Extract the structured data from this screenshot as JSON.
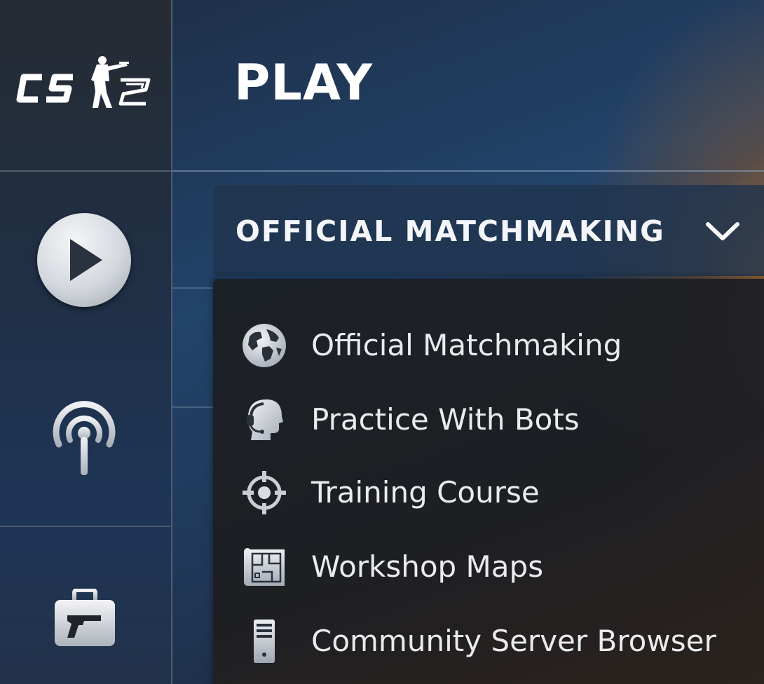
{
  "sidebar": {
    "logo_text": "CS2",
    "nav": [
      {
        "id": "play",
        "icon": "play-icon"
      },
      {
        "id": "watch",
        "icon": "broadcast-icon"
      },
      {
        "id": "inventory",
        "icon": "briefcase-pistol-icon"
      }
    ]
  },
  "header": {
    "title": "PLAY"
  },
  "mode_dropdown": {
    "selected": "OFFICIAL MATCHMAKING",
    "expanded": true,
    "options": [
      {
        "label": "Official Matchmaking",
        "icon": "globe-icon"
      },
      {
        "label": "Practice With Bots",
        "icon": "bot-headset-icon"
      },
      {
        "label": "Training Course",
        "icon": "crosshair-icon"
      },
      {
        "label": "Workshop Maps",
        "icon": "blueprint-map-icon"
      },
      {
        "label": "Community Server Browser",
        "icon": "server-tower-icon"
      }
    ]
  },
  "colors": {
    "accent_orange": "#d2822d",
    "panel_dark": "#1c1f25",
    "text_primary": "#ffffff"
  }
}
